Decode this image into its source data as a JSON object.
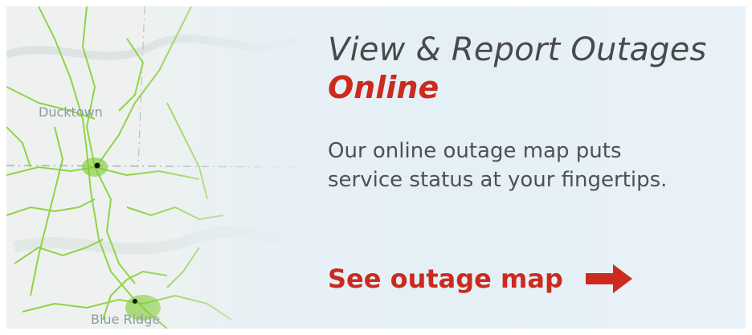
{
  "banner": {
    "title": "View & Report Outages",
    "highlight": "Online",
    "description_line1": "Our online outage map puts",
    "description_line2": "service status at your fingertips.",
    "cta_label": "See outage map"
  },
  "map": {
    "town_north": "Ducktown",
    "town_south": "Blue Ridge"
  },
  "colors": {
    "accent": "#cc2a1f",
    "network": "#8ad33c",
    "text": "#4a4a4a"
  }
}
